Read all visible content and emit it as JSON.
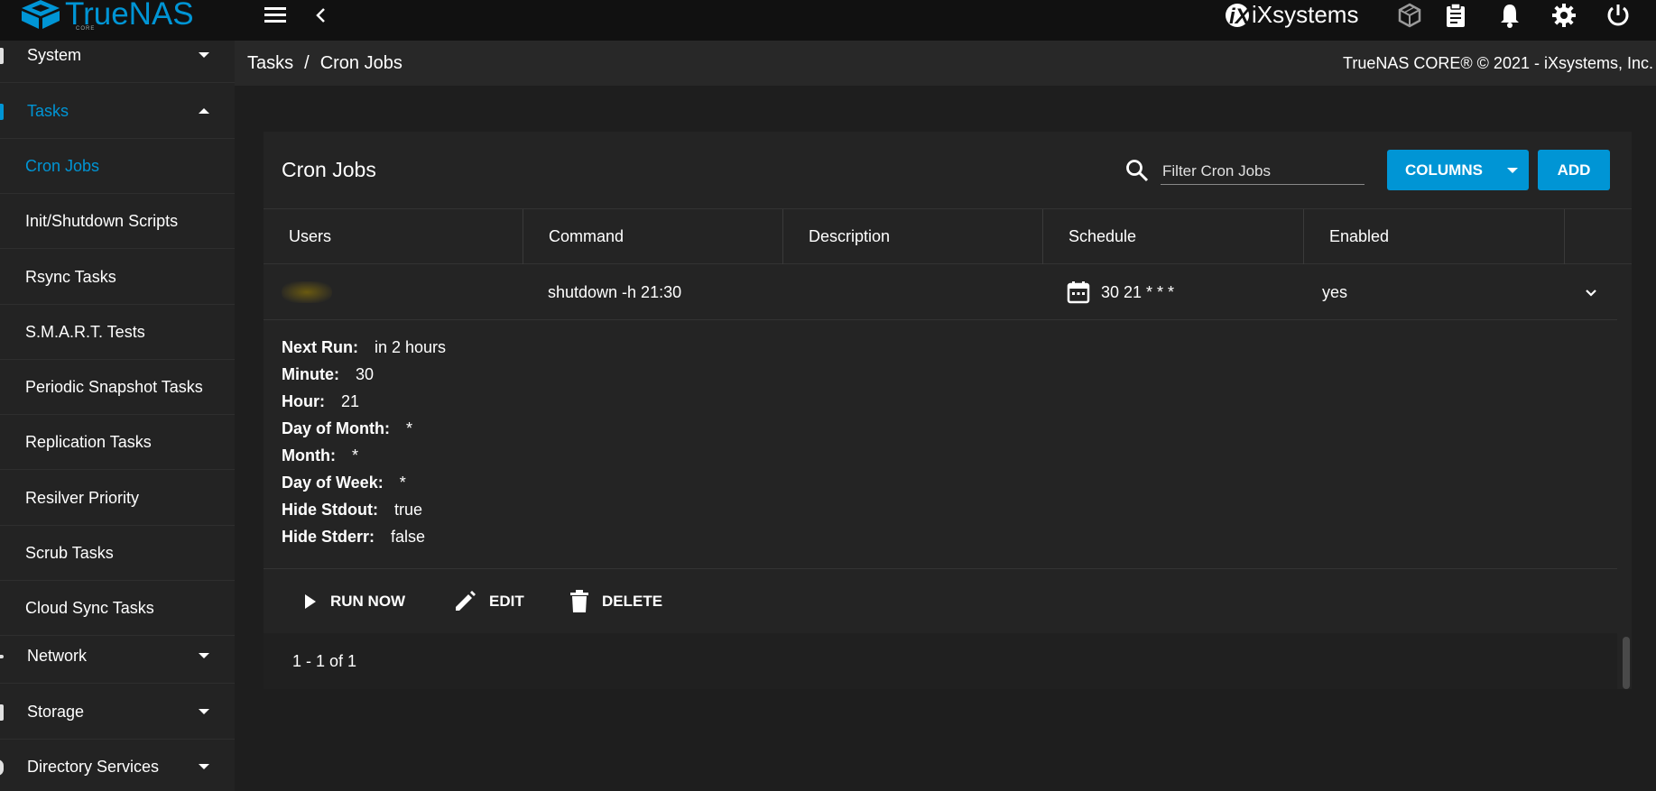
{
  "topbar": {
    "logo_text": "TrueNAS",
    "logo_subtext": "CORE",
    "vendor_logo": "iXsystems",
    "icons": [
      "menu-icon",
      "back-chevron-icon",
      "truecommand-icon",
      "clipboard-icon",
      "bell-icon",
      "gear-icon",
      "power-icon"
    ]
  },
  "sidebar": {
    "sections": [
      {
        "label": "System",
        "expanded": false
      },
      {
        "label": "Tasks",
        "expanded": true
      },
      {
        "label": "Network",
        "expanded": false
      },
      {
        "label": "Storage",
        "expanded": false
      },
      {
        "label": "Directory Services",
        "expanded": false
      }
    ],
    "task_items": [
      {
        "label": "Cron Jobs",
        "active": true
      },
      {
        "label": "Init/Shutdown Scripts"
      },
      {
        "label": "Rsync Tasks"
      },
      {
        "label": "S.M.A.R.T. Tests"
      },
      {
        "label": "Periodic Snapshot Tasks"
      },
      {
        "label": "Replication Tasks"
      },
      {
        "label": "Resilver Priority"
      },
      {
        "label": "Scrub Tasks"
      },
      {
        "label": "Cloud Sync Tasks"
      }
    ]
  },
  "breadcrumb": {
    "parent": "Tasks",
    "separator": "/",
    "current": "Cron Jobs"
  },
  "copyright": "TrueNAS CORE® © 2021 - iXsystems, Inc.",
  "card": {
    "title": "Cron Jobs",
    "filter_placeholder": "Filter Cron Jobs",
    "columns_button": "COLUMNS",
    "add_button": "ADD"
  },
  "table": {
    "columns": [
      "Users",
      "Command",
      "Description",
      "Schedule",
      "Enabled"
    ],
    "rows": [
      {
        "user": "",
        "command": "shutdown -h 21:30",
        "description": "",
        "schedule": "30 21 * * *",
        "enabled": "yes"
      }
    ]
  },
  "details": [
    {
      "key": "Next Run:",
      "value": "in 2 hours"
    },
    {
      "key": "Minute:",
      "value": "30"
    },
    {
      "key": "Hour:",
      "value": "21"
    },
    {
      "key": "Day of Month:",
      "value": "*"
    },
    {
      "key": "Month:",
      "value": "*"
    },
    {
      "key": "Day of Week:",
      "value": "*"
    },
    {
      "key": "Hide Stdout:",
      "value": "true"
    },
    {
      "key": "Hide Stderr:",
      "value": "false"
    }
  ],
  "actions": {
    "run_now": "RUN NOW",
    "edit": "EDIT",
    "delete": "DELETE"
  },
  "pager": "1 - 1 of 1",
  "colors": {
    "accent": "#0095d5",
    "topbar_bg": "#111111",
    "sidebar_bg": "#232323",
    "card_bg": "#242424"
  }
}
